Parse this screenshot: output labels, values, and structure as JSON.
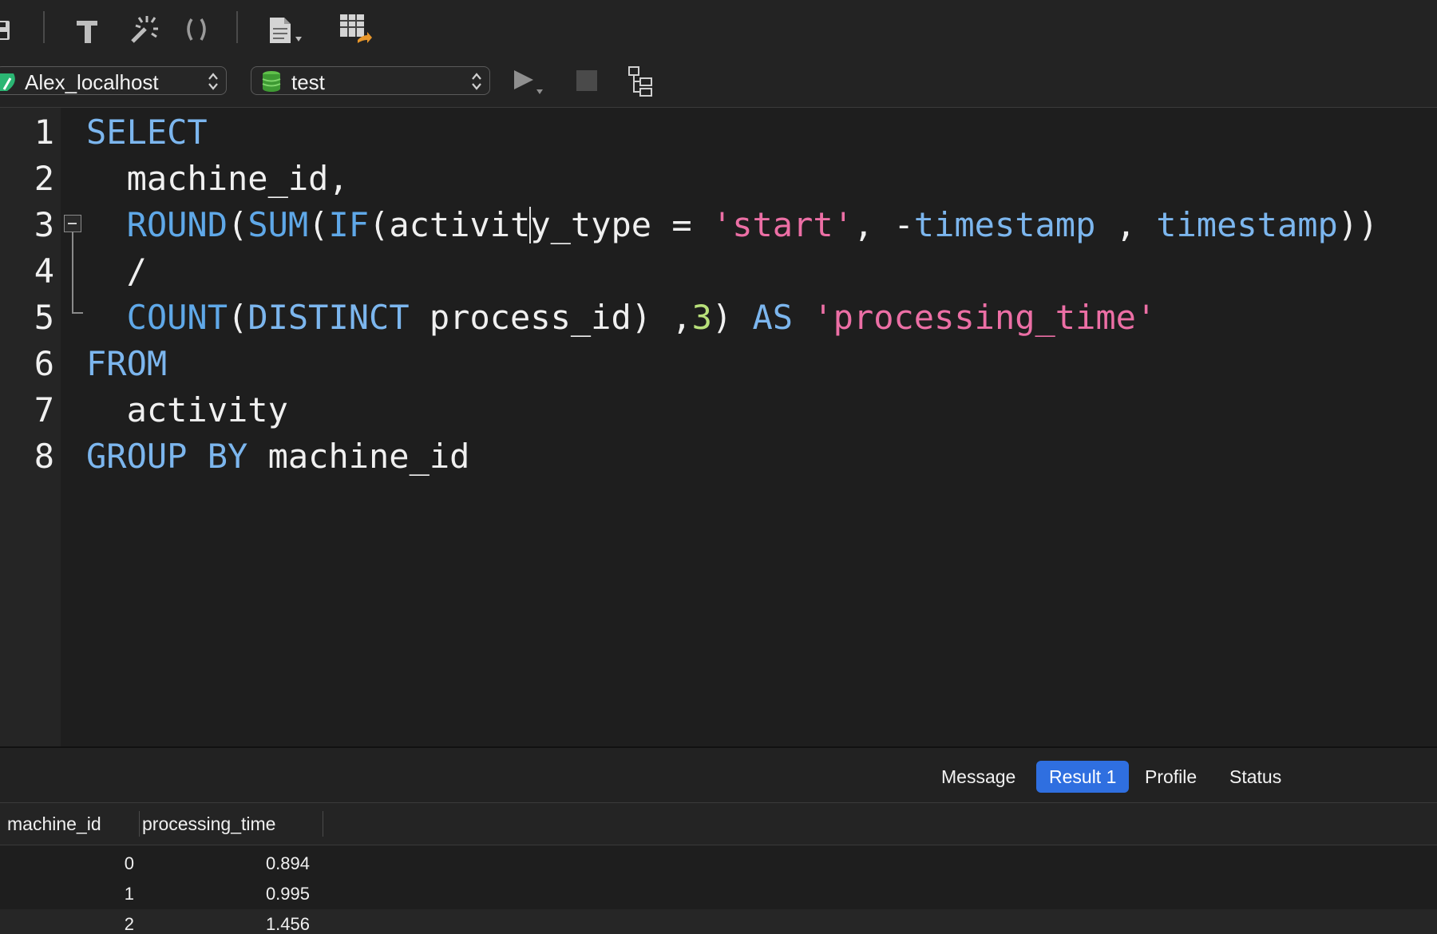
{
  "connection": {
    "server_name": "Alex_localhost",
    "database_name": "test"
  },
  "editor": {
    "line_numbers": [
      "1",
      "2",
      "3",
      "4",
      "5",
      "6",
      "7",
      "8"
    ],
    "lines": [
      [
        {
          "t": "SELECT",
          "c": "kw"
        }
      ],
      [
        {
          "t": "  machine_id,",
          "c": "pl"
        }
      ],
      [
        {
          "t": "  ",
          "c": "pl"
        },
        {
          "t": "ROUND",
          "c": "fn"
        },
        {
          "t": "(",
          "c": "pl"
        },
        {
          "t": "SUM",
          "c": "fn"
        },
        {
          "t": "(",
          "c": "pl"
        },
        {
          "t": "IF",
          "c": "fn"
        },
        {
          "t": "(activity_type = ",
          "c": "pl"
        },
        {
          "t": "'start'",
          "c": "str"
        },
        {
          "t": ", -",
          "c": "pl"
        },
        {
          "t": "timestamp",
          "c": "kw"
        },
        {
          "t": " , ",
          "c": "pl"
        },
        {
          "t": "timestamp",
          "c": "kw"
        },
        {
          "t": "))",
          "c": "pl"
        }
      ],
      [
        {
          "t": "  /",
          "c": "pl"
        }
      ],
      [
        {
          "t": "  ",
          "c": "pl"
        },
        {
          "t": "COUNT",
          "c": "fn"
        },
        {
          "t": "(",
          "c": "pl"
        },
        {
          "t": "DISTINCT",
          "c": "kw"
        },
        {
          "t": " process_id) ,",
          "c": "pl"
        },
        {
          "t": "3",
          "c": "num"
        },
        {
          "t": ") ",
          "c": "pl"
        },
        {
          "t": "AS",
          "c": "kw"
        },
        {
          "t": " ",
          "c": "pl"
        },
        {
          "t": "'processing_time'",
          "c": "str"
        }
      ],
      [
        {
          "t": "FROM",
          "c": "kw"
        }
      ],
      [
        {
          "t": "  activity",
          "c": "pl"
        }
      ],
      [
        {
          "t": "GROUP BY",
          "c": "kw"
        },
        {
          "t": " machine_id",
          "c": "pl"
        }
      ]
    ]
  },
  "result_tabs": {
    "message": "Message",
    "result1": "Result 1",
    "profile": "Profile",
    "status": "Status",
    "active": "result1"
  },
  "results": {
    "columns": [
      "machine_id",
      "processing_time"
    ],
    "rows": [
      [
        "0",
        "0.894"
      ],
      [
        "1",
        "0.995"
      ],
      [
        "2",
        "1.456"
      ]
    ]
  },
  "colors": {
    "keyword": "#7cb6ee",
    "function": "#5fa8e8",
    "string": "#ec6fa5",
    "number": "#b8e07a",
    "active_tab": "#2f6fe0"
  },
  "icons": [
    "save-icon",
    "hammer-icon",
    "magic-wand-icon",
    "parentheses-icon",
    "document-icon",
    "table-export-icon",
    "connection-icon",
    "database-icon",
    "run-icon",
    "stop-icon",
    "explain-icon"
  ]
}
